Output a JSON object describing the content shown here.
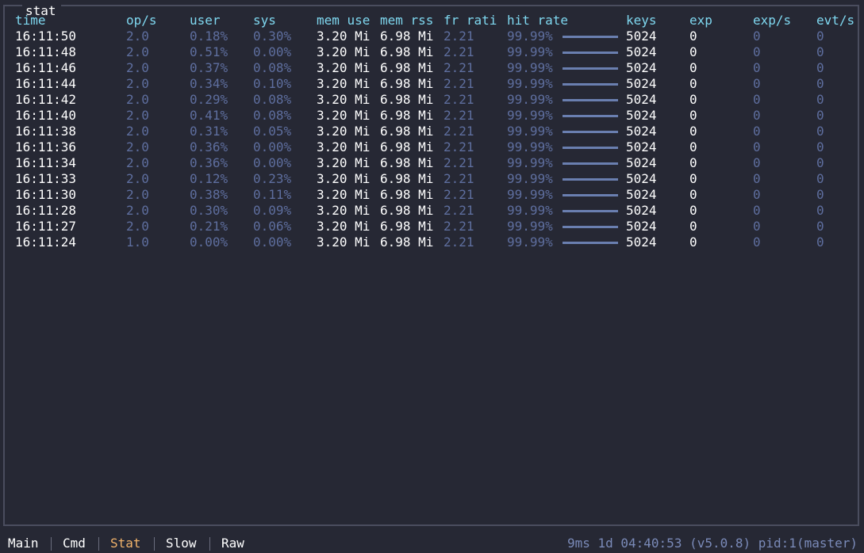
{
  "panel": {
    "title": "stat"
  },
  "columns": [
    {
      "key": "time",
      "label": "time"
    },
    {
      "key": "ops",
      "label": "op/s"
    },
    {
      "key": "user",
      "label": "user"
    },
    {
      "key": "sys",
      "label": "sys"
    },
    {
      "key": "mem_use",
      "label": "mem use"
    },
    {
      "key": "mem_rss",
      "label": "mem rss"
    },
    {
      "key": "fr_ratio",
      "label": "fr rati"
    },
    {
      "key": "hit_rate",
      "label": "hit rate"
    },
    {
      "key": "keys",
      "label": "keys"
    },
    {
      "key": "exp",
      "label": "exp"
    },
    {
      "key": "exps",
      "label": "exp/s"
    },
    {
      "key": "evts",
      "label": "evt/s"
    }
  ],
  "rows": [
    {
      "time": "16:11:50",
      "ops": "2.0",
      "user": "0.18%",
      "sys": "0.30%",
      "mem_use": "3.20 Mi",
      "mem_rss": "6.98 Mi",
      "fr_ratio": "2.21",
      "hit_rate": "99.99%",
      "hit_rate_fraction": 0.9999,
      "keys": "5024",
      "exp": "0",
      "exps": "0",
      "evts": "0"
    },
    {
      "time": "16:11:48",
      "ops": "2.0",
      "user": "0.51%",
      "sys": "0.00%",
      "mem_use": "3.20 Mi",
      "mem_rss": "6.98 Mi",
      "fr_ratio": "2.21",
      "hit_rate": "99.99%",
      "hit_rate_fraction": 0.9999,
      "keys": "5024",
      "exp": "0",
      "exps": "0",
      "evts": "0"
    },
    {
      "time": "16:11:46",
      "ops": "2.0",
      "user": "0.37%",
      "sys": "0.08%",
      "mem_use": "3.20 Mi",
      "mem_rss": "6.98 Mi",
      "fr_ratio": "2.21",
      "hit_rate": "99.99%",
      "hit_rate_fraction": 0.9999,
      "keys": "5024",
      "exp": "0",
      "exps": "0",
      "evts": "0"
    },
    {
      "time": "16:11:44",
      "ops": "2.0",
      "user": "0.34%",
      "sys": "0.10%",
      "mem_use": "3.20 Mi",
      "mem_rss": "6.98 Mi",
      "fr_ratio": "2.21",
      "hit_rate": "99.99%",
      "hit_rate_fraction": 0.9999,
      "keys": "5024",
      "exp": "0",
      "exps": "0",
      "evts": "0"
    },
    {
      "time": "16:11:42",
      "ops": "2.0",
      "user": "0.29%",
      "sys": "0.08%",
      "mem_use": "3.20 Mi",
      "mem_rss": "6.98 Mi",
      "fr_ratio": "2.21",
      "hit_rate": "99.99%",
      "hit_rate_fraction": 0.9999,
      "keys": "5024",
      "exp": "0",
      "exps": "0",
      "evts": "0"
    },
    {
      "time": "16:11:40",
      "ops": "2.0",
      "user": "0.41%",
      "sys": "0.08%",
      "mem_use": "3.20 Mi",
      "mem_rss": "6.98 Mi",
      "fr_ratio": "2.21",
      "hit_rate": "99.99%",
      "hit_rate_fraction": 0.9999,
      "keys": "5024",
      "exp": "0",
      "exps": "0",
      "evts": "0"
    },
    {
      "time": "16:11:38",
      "ops": "2.0",
      "user": "0.31%",
      "sys": "0.05%",
      "mem_use": "3.20 Mi",
      "mem_rss": "6.98 Mi",
      "fr_ratio": "2.21",
      "hit_rate": "99.99%",
      "hit_rate_fraction": 0.9999,
      "keys": "5024",
      "exp": "0",
      "exps": "0",
      "evts": "0"
    },
    {
      "time": "16:11:36",
      "ops": "2.0",
      "user": "0.36%",
      "sys": "0.00%",
      "mem_use": "3.20 Mi",
      "mem_rss": "6.98 Mi",
      "fr_ratio": "2.21",
      "hit_rate": "99.99%",
      "hit_rate_fraction": 0.9999,
      "keys": "5024",
      "exp": "0",
      "exps": "0",
      "evts": "0"
    },
    {
      "time": "16:11:34",
      "ops": "2.0",
      "user": "0.36%",
      "sys": "0.00%",
      "mem_use": "3.20 Mi",
      "mem_rss": "6.98 Mi",
      "fr_ratio": "2.21",
      "hit_rate": "99.99%",
      "hit_rate_fraction": 0.9999,
      "keys": "5024",
      "exp": "0",
      "exps": "0",
      "evts": "0"
    },
    {
      "time": "16:11:33",
      "ops": "2.0",
      "user": "0.12%",
      "sys": "0.23%",
      "mem_use": "3.20 Mi",
      "mem_rss": "6.98 Mi",
      "fr_ratio": "2.21",
      "hit_rate": "99.99%",
      "hit_rate_fraction": 0.9999,
      "keys": "5024",
      "exp": "0",
      "exps": "0",
      "evts": "0"
    },
    {
      "time": "16:11:30",
      "ops": "2.0",
      "user": "0.38%",
      "sys": "0.11%",
      "mem_use": "3.20 Mi",
      "mem_rss": "6.98 Mi",
      "fr_ratio": "2.21",
      "hit_rate": "99.99%",
      "hit_rate_fraction": 0.9999,
      "keys": "5024",
      "exp": "0",
      "exps": "0",
      "evts": "0"
    },
    {
      "time": "16:11:28",
      "ops": "2.0",
      "user": "0.30%",
      "sys": "0.09%",
      "mem_use": "3.20 Mi",
      "mem_rss": "6.98 Mi",
      "fr_ratio": "2.21",
      "hit_rate": "99.99%",
      "hit_rate_fraction": 0.9999,
      "keys": "5024",
      "exp": "0",
      "exps": "0",
      "evts": "0"
    },
    {
      "time": "16:11:27",
      "ops": "2.0",
      "user": "0.21%",
      "sys": "0.06%",
      "mem_use": "3.20 Mi",
      "mem_rss": "6.98 Mi",
      "fr_ratio": "2.21",
      "hit_rate": "99.99%",
      "hit_rate_fraction": 0.9999,
      "keys": "5024",
      "exp": "0",
      "exps": "0",
      "evts": "0"
    },
    {
      "time": "16:11:24",
      "ops": "1.0",
      "user": "0.00%",
      "sys": "0.00%",
      "mem_use": "3.20 Mi",
      "mem_rss": "6.98 Mi",
      "fr_ratio": "2.21",
      "hit_rate": "99.99%",
      "hit_rate_fraction": 0.9999,
      "keys": "5024",
      "exp": "0",
      "exps": "0",
      "evts": "0"
    }
  ],
  "footer": {
    "tabs": [
      {
        "label": "Main",
        "active": false
      },
      {
        "label": "Cmd",
        "active": false
      },
      {
        "label": "Stat",
        "active": true
      },
      {
        "label": "Slow",
        "active": false
      },
      {
        "label": "Raw",
        "active": false
      }
    ],
    "status": "9ms 1d 04:40:53 (v5.0.8) pid:1(master)"
  },
  "colors": {
    "background": "#262834",
    "header": "#7fd8f0",
    "dim_value": "#5e6e9e",
    "bright_value": "#ffffff",
    "active_tab": "#f2b36a",
    "status": "#7a8ab8",
    "bar": "#6a7fb0"
  }
}
